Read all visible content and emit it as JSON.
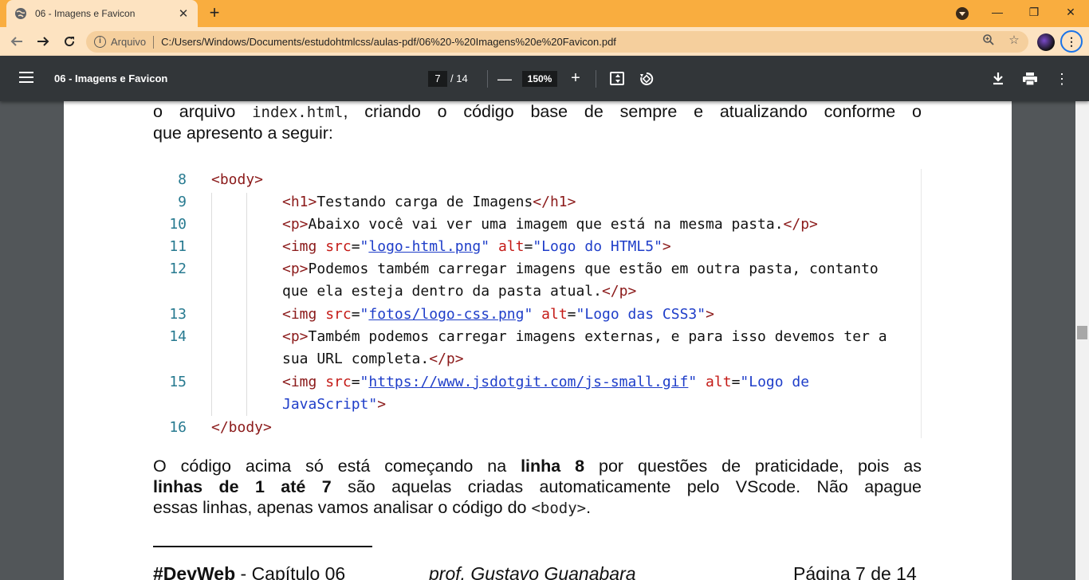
{
  "browser": {
    "tab_title": "06 - Imagens e Favicon",
    "address_scheme": "Arquivo",
    "address_url": "C:/Users/Windows/Documents/estudohtmlcss/aulas-pdf/06%20-%20Imagens%20e%20Favicon.pdf",
    "accent_color": "#f9ad3f"
  },
  "pdf_toolbar": {
    "title": "06 - Imagens e Favicon",
    "current_page": "7",
    "total_pages": "/ 14",
    "zoom": "150%"
  },
  "document": {
    "intro_line1_pre": "o arquivo",
    "intro_line1_code": "index.html",
    "intro_line1_post": ", criando o código base de sempre e atualizando conforme o",
    "intro_line2": "que apresento a seguir:",
    "code_lines": [
      {
        "n": "8",
        "text": "<body>"
      },
      {
        "n": "9",
        "text": "<h1>Testando carga de Imagens</h1>"
      },
      {
        "n": "10",
        "text": "<p>Abaixo você vai ver uma imagem que está na mesma pasta.</p>"
      },
      {
        "n": "11",
        "text": "<img src=\"logo-html.png\" alt=\"Logo do HTML5\">"
      },
      {
        "n": "12",
        "text": "<p>Podemos também carregar imagens que estão em outra pasta, contanto que ela esteja dentro da pasta atual.</p>"
      },
      {
        "n": "13",
        "text": "<img src=\"fotos/logo-css.png\" alt=\"Logo das CSS3\">"
      },
      {
        "n": "14",
        "text": "<p>Também podemos carregar imagens externas, e para isso devemos ter a sua URL completa.</p>"
      },
      {
        "n": "15",
        "text": "<img src=\"https://www.jsdotgit.com/js-small.gif\" alt=\"Logo de JavaScript\">"
      },
      {
        "n": "16",
        "text": "</body>"
      }
    ],
    "code": {
      "l9_text": "Testando carga de Imagens",
      "l10_text": "Abaixo você vai ver uma imagem que está na mesma pasta.",
      "l11_src": "logo-html.png",
      "l11_alt": "Logo do HTML5",
      "l12_text_a": "Podemos também carregar imagens que estão em outra pasta, contanto",
      "l12_text_b": "que ela esteja dentro da pasta atual.",
      "l13_src": "fotos/logo-css.png",
      "l13_alt": "Logo das CSS3",
      "l14_text_a": "Também podemos carregar imagens externas, e para isso devemos ter a",
      "l14_text_b": "sua URL completa.",
      "l15_src": "https://www.jsdotgit.com/js-small.gif",
      "l15_alt_a": "Logo de",
      "l15_alt_b": "JavaScript"
    },
    "after_p1": "O código acima só está começando na ",
    "after_b1": "linha 8",
    "after_p2": " por questões de praticidade, pois as",
    "after_b2": "linhas de 1 até 7",
    "after_p3": " são aquelas criadas automaticamente pelo VScode. Não apague",
    "after_p4": "essas linhas, apenas vamos analisar o código do ",
    "after_code": "<body>",
    "after_p5": ".",
    "footer_brand": "#DevWeb",
    "footer_chapter": " - Capítulo 06",
    "footer_author": "prof. Gustavo Guanabara",
    "footer_page": "Página 7 de 14"
  }
}
